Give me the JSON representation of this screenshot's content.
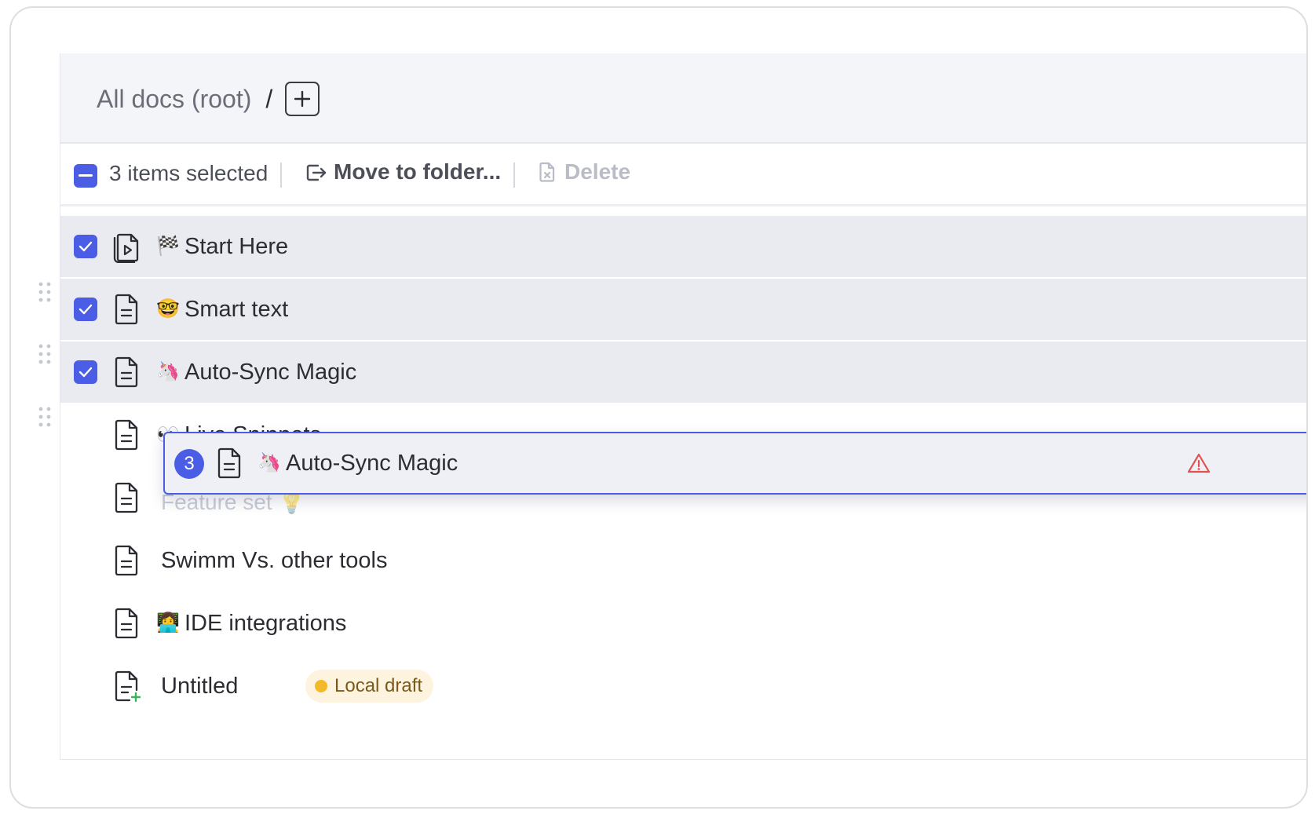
{
  "breadcrumb": {
    "root_label": "All docs (root)",
    "separator": "/",
    "add_icon": "plus-icon"
  },
  "toolbar": {
    "selection_state": "indeterminate",
    "selected_count_label": "3 items selected",
    "move_label": "Move to folder...",
    "move_icon": "move-to-folder-icon",
    "delete_label": "Delete",
    "delete_icon": "delete-doc-icon",
    "delete_enabled": false
  },
  "docs": [
    {
      "emoji": "🏁",
      "title": "Start Here",
      "icon": "playlist-doc-icon",
      "selected": true
    },
    {
      "emoji": "🤓",
      "title": "Smart text",
      "icon": "doc-icon",
      "selected": true
    },
    {
      "emoji": "🦄",
      "title": "Auto-Sync Magic",
      "icon": "doc-icon",
      "selected": true
    },
    {
      "emoji": "👀",
      "title": "Live Snippets",
      "icon": "doc-icon",
      "selected": false
    },
    {
      "emoji": "",
      "title": "Feature set",
      "trailing_emoji": "💡",
      "icon": "doc-icon",
      "selected": false,
      "obscured": true
    },
    {
      "emoji": "",
      "title": "Swimm Vs. other tools",
      "icon": "doc-icon",
      "selected": false
    },
    {
      "emoji": "👩‍💻",
      "title": "IDE integrations",
      "icon": "doc-icon",
      "selected": false
    },
    {
      "emoji": "",
      "title": "Untitled",
      "icon": "new-doc-icon",
      "selected": false,
      "badge": "Local draft"
    }
  ],
  "drag_preview": {
    "count": "3",
    "emoji": "🦄",
    "title": "Auto-Sync Magic",
    "icon": "doc-icon",
    "warning_icon": "warning-icon"
  },
  "colors": {
    "accent": "#4b5de4",
    "selected_row_bg": "#e9ebf1",
    "header_bg": "#f4f5f8",
    "draft_badge_bg": "#fdf3df",
    "draft_dot": "#f3b929",
    "warning": "#e0514f"
  }
}
